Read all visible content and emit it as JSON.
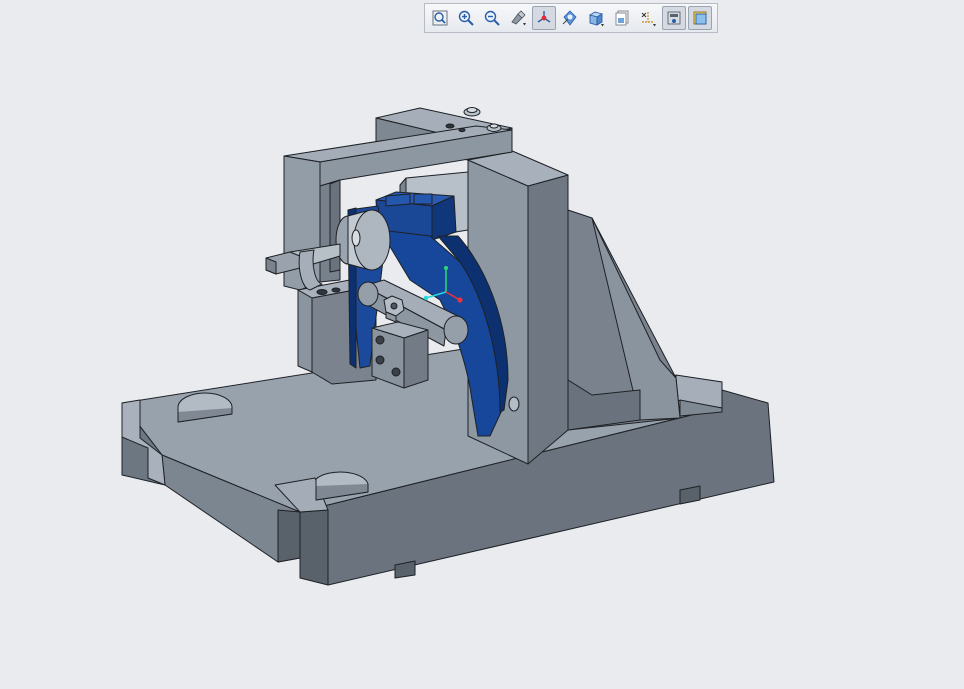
{
  "app": {
    "viewport_background": "#e9ebef"
  },
  "toolbar": {
    "buttons": [
      {
        "name": "refit",
        "icon": "refit-icon",
        "active": false
      },
      {
        "name": "zoom-in",
        "icon": "zoom-in-icon",
        "active": false
      },
      {
        "name": "zoom-out",
        "icon": "zoom-out-icon",
        "active": false
      },
      {
        "name": "repaint",
        "icon": "repaint-icon",
        "active": false
      },
      {
        "name": "spin-center",
        "icon": "spin-center-icon",
        "active": true
      },
      {
        "name": "view-manager",
        "icon": "view-manager-icon",
        "active": false
      },
      {
        "name": "display-style",
        "icon": "shaded-cube-icon",
        "active": false
      },
      {
        "name": "saved-orientations",
        "icon": "saved-views-icon",
        "active": false
      },
      {
        "name": "datum-display",
        "icon": "datum-display-icon",
        "active": false
      },
      {
        "name": "annotation-display",
        "icon": "annotation-display-icon",
        "active": true
      },
      {
        "name": "model-display",
        "icon": "model-display-icon",
        "active": true
      }
    ]
  },
  "model": {
    "base_color": "#8f9aa6",
    "part_highlight_color": "#17479a",
    "csys_axis_colors": [
      "#2ad87a",
      "#24d8d8",
      "#e8323c"
    ]
  }
}
